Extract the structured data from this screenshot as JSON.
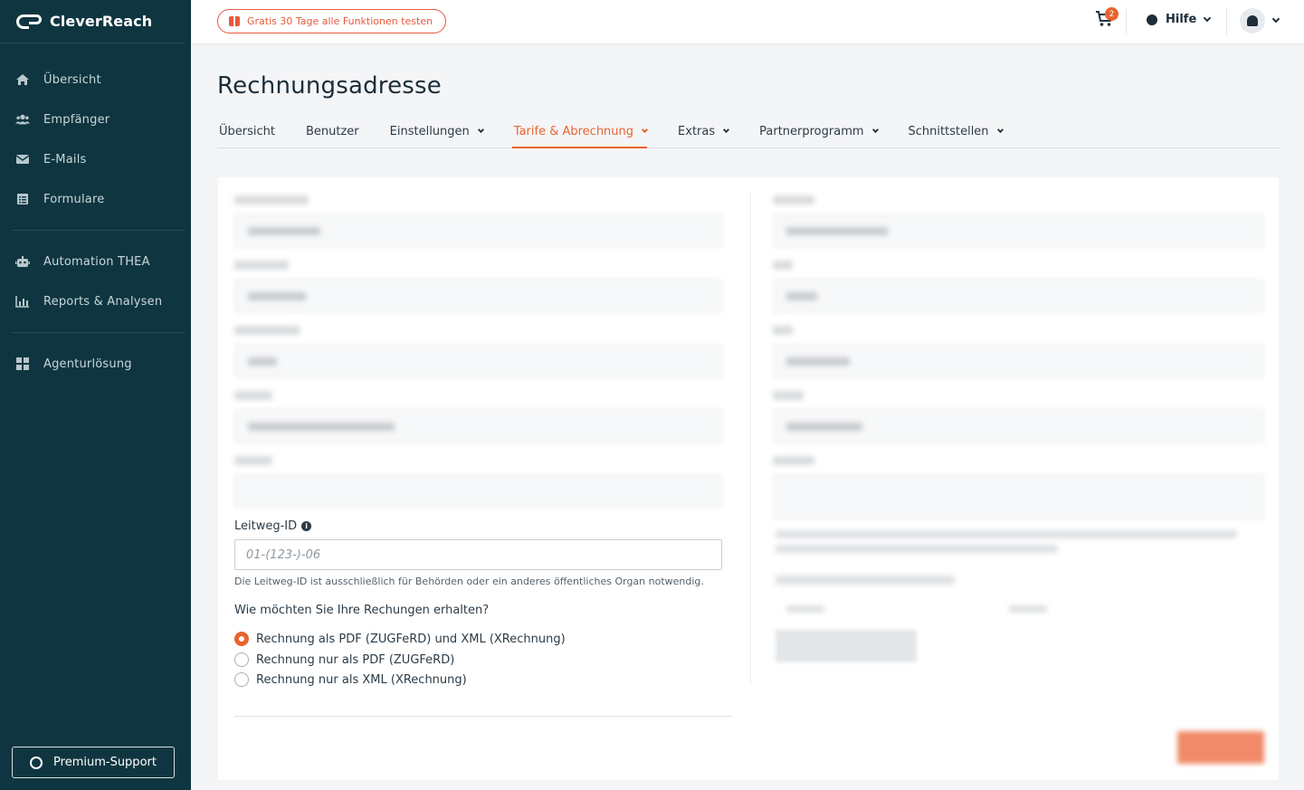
{
  "app": {
    "brand": "CleverReach"
  },
  "sidebar": {
    "items": [
      {
        "label": "Übersicht",
        "icon": "home-icon"
      },
      {
        "label": "Empfänger",
        "icon": "users-icon"
      },
      {
        "label": "E-Mails",
        "icon": "mail-icon"
      },
      {
        "label": "Formulare",
        "icon": "form-icon"
      },
      {
        "label": "Automation THEA",
        "icon": "robot-icon"
      },
      {
        "label": "Reports & Analysen",
        "icon": "chart-icon"
      },
      {
        "label": "Agenturlösung",
        "icon": "grid-icon"
      }
    ],
    "support_label": "Premium-Support"
  },
  "topbar": {
    "trial_label": "Gratis 30 Tage alle Funktionen testen",
    "cart_count": "2",
    "help_label": "Hilfe"
  },
  "page": {
    "title": "Rechnungsadresse",
    "tabs": [
      {
        "label": "Übersicht"
      },
      {
        "label": "Benutzer"
      },
      {
        "label": "Einstellungen"
      },
      {
        "label": "Tarife & Abrechnung"
      },
      {
        "label": "Extras"
      },
      {
        "label": "Partnerprogramm"
      },
      {
        "label": "Schnittstellen"
      }
    ]
  },
  "form": {
    "leitweg_label": "Leitweg-ID",
    "leitweg_placeholder": "01-(123-)-06",
    "leitweg_hint": "Die Leitweg-ID ist ausschließlich für Behörden oder ein anderes öffentliches Organ notwendig.",
    "delivery_question": "Wie möchten Sie Ihre Rechungen erhalten?",
    "delivery_options": [
      {
        "label": "Rechnung als PDF (ZUGFeRD) und XML (XRechnung)",
        "selected": true
      },
      {
        "label": "Rechnung nur als PDF (ZUGFeRD)",
        "selected": false
      },
      {
        "label": "Rechnung nur als XML (XRechnung)",
        "selected": false
      }
    ]
  },
  "colors": {
    "accent": "#e8632f",
    "sidebar_bg": "#0f3640"
  }
}
